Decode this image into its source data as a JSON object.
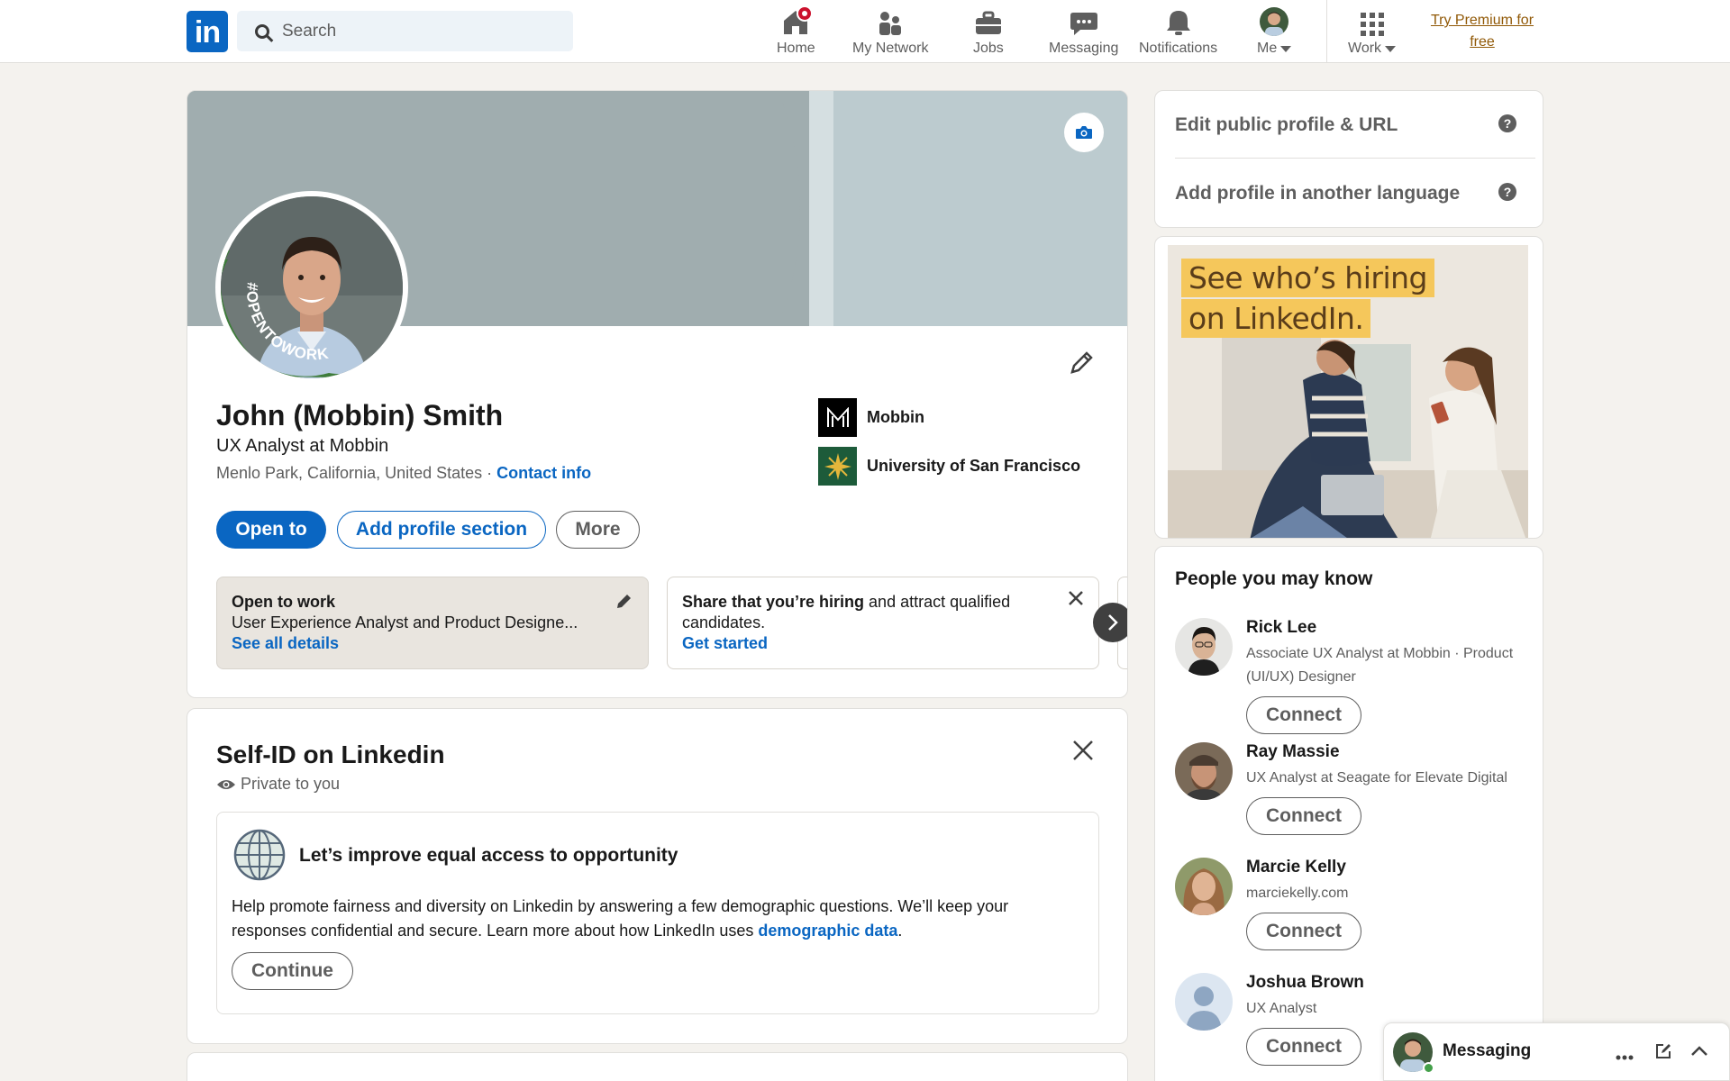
{
  "nav": {
    "logo_text": "in",
    "search_placeholder": "Search",
    "items": [
      {
        "label": "Home",
        "icon": "home-icon"
      },
      {
        "label": "My Network",
        "icon": "people-icon"
      },
      {
        "label": "Jobs",
        "icon": "briefcase-icon"
      },
      {
        "label": "Messaging",
        "icon": "chat-icon"
      },
      {
        "label": "Notifications",
        "icon": "bell-icon"
      },
      {
        "label": "Me",
        "icon": "avatar-icon"
      },
      {
        "label": "Work",
        "icon": "grid-icon"
      }
    ],
    "premium": "Try Premium for free"
  },
  "profile": {
    "badge_text": "#OPENTOWORK",
    "name": "John (Mobbin) Smith",
    "headline": "UX Analyst at Mobbin",
    "location": "Menlo Park, California, United States",
    "location_sep": " · ",
    "contact_info": "Contact info",
    "orgs": [
      {
        "name": "Mobbin",
        "icon": "mobbin-logo-icon"
      },
      {
        "name": "University of San Francisco",
        "icon": "usf-logo-icon"
      }
    ],
    "buttons": {
      "open_to": "Open to",
      "add_section": "Add profile section",
      "more": "More"
    },
    "open_to_work": {
      "title": "Open to work",
      "detail": "User Experience Analyst and Product Designe...",
      "link": "See all details"
    },
    "hiring": {
      "bold": "Share that you’re hiring",
      "rest": " and attract qualified candidates.",
      "link": "Get started"
    }
  },
  "self_id": {
    "title": "Self-ID on Linkedin",
    "privacy": "Private to you",
    "heading": "Let’s improve equal access to opportunity",
    "body": "Help promote fairness and diversity on Linkedin by answering a few demographic questions. We’ll keep your responses confidential and secure. Learn more about how LinkedIn uses ",
    "link": "demographic data",
    "end": ".",
    "button": "Continue"
  },
  "sidebar": {
    "edit_public_profile": "Edit public profile & URL",
    "add_language": "Add profile in another language",
    "help_glyph": "?",
    "ad_lines": [
      "See who’s hiring",
      "on LinkedIn."
    ],
    "pymk_title": "People you may know",
    "connect_label": "Connect",
    "people": [
      {
        "name": "Rick Lee",
        "headline": "Associate UX Analyst at Mobbin · Product (UI/UX) Designer"
      },
      {
        "name": "Ray Massie",
        "headline": "UX Analyst at Seagate for Elevate Digital"
      },
      {
        "name": "Marcie Kelly",
        "headline": "marciekelly.com"
      },
      {
        "name": "Joshua Brown",
        "headline": "UX Analyst"
      }
    ]
  },
  "messaging_dock": {
    "label": "Messaging"
  },
  "colors": {
    "brand": "#0a66c2",
    "premium": "#915907",
    "notification": "#cb112d",
    "page_bg": "#f4f2ee"
  }
}
